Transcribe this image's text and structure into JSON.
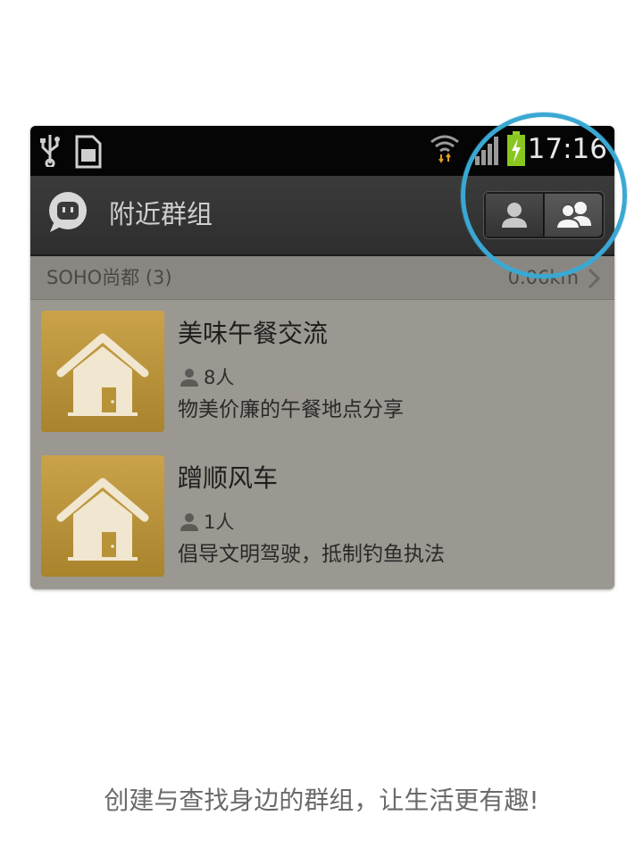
{
  "status_bar": {
    "time": "17:16",
    "icons": [
      "usb-icon",
      "sd-card-icon",
      "wifi-icon",
      "signal-icon",
      "battery-charging-icon"
    ]
  },
  "action_bar": {
    "title": "附近群组",
    "logo_icon": "chat-bubble-logo",
    "toggle": {
      "options": [
        "person-icon",
        "group-icon"
      ],
      "selected": "group-icon"
    }
  },
  "section": {
    "title": "SOHO尚都 (3)",
    "distance": "0.06km"
  },
  "groups": [
    {
      "title": "美味午餐交流",
      "members": "8人",
      "description": "物美价廉的午餐地点分享",
      "icon": "house-icon"
    },
    {
      "title": "蹭顺风车",
      "members": "1人",
      "description": "倡导文明驾驶，抵制钓鱼执法",
      "icon": "house-icon"
    }
  ],
  "caption": "创建与查找身边的群组，让生活更有趣!",
  "colors": {
    "highlight_ring": "#3aa8d2",
    "thumb_gold": "#c9a24a",
    "action_bar": "#333333",
    "overlay_gray": "#9b9791"
  }
}
